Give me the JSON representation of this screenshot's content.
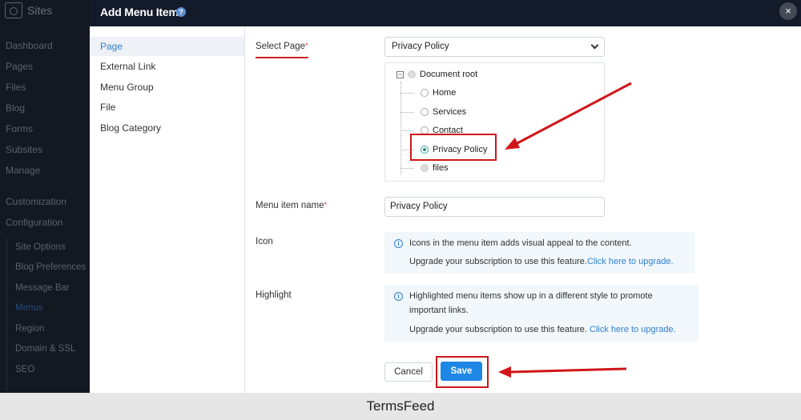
{
  "app": {
    "brand": "Sites",
    "nav": [
      "Dashboard",
      "Pages",
      "Files",
      "Blog",
      "Forms",
      "Subsites",
      "Manage",
      "Customization",
      "Configuration"
    ],
    "subnav": [
      "Site Options",
      "Blog Preferences",
      "Message Bar",
      "Menus",
      "Region",
      "Domain & SSL",
      "SEO"
    ],
    "active_subnav": "Menus"
  },
  "modal": {
    "title": "Add Menu Item",
    "help_icon": "?",
    "close_icon": "×",
    "types": [
      "Page",
      "External Link",
      "Menu Group",
      "File",
      "Blog Category"
    ],
    "active_type": "Page",
    "select_page": {
      "label": "Select Page",
      "required_mark": "*",
      "value": "Privacy Policy"
    },
    "tree": {
      "collapse_icon": "−",
      "root": "Document root",
      "items": [
        "Home",
        "Services",
        "Contact",
        "Privacy Policy",
        "files"
      ],
      "selected": "Privacy Policy"
    },
    "menu_item_name": {
      "label": "Menu item name",
      "required_mark": "*",
      "value": "Privacy Policy"
    },
    "icon": {
      "label": "Icon",
      "info_icon": "i",
      "message": "Icons in the menu item adds visual appeal to the content.",
      "upgrade_text": "Upgrade your subscription to use this feature.",
      "upgrade_link": "Click here to upgrade."
    },
    "highlight": {
      "label": "Highlight",
      "info_icon": "i",
      "message_line1": "Highlighted menu items show up in a different style to promote",
      "message_line2": "important links.",
      "upgrade_text": "Upgrade your subscription to use this feature.",
      "upgrade_link": "Click here to upgrade."
    },
    "buttons": {
      "cancel": "Cancel",
      "save": "Save"
    }
  },
  "footer": {
    "caption": "TermsFeed"
  },
  "colors": {
    "annotation_red": "#d0161a",
    "primary_blue": "#1e87e6",
    "link_blue": "#2f7fd0",
    "header_dark": "#131a29"
  }
}
